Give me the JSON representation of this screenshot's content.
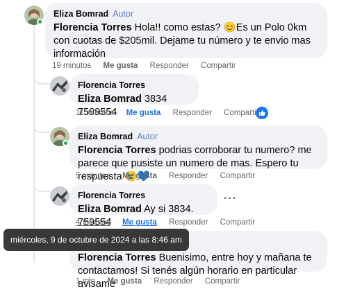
{
  "comments": [
    {
      "author": "Eliza Bomrad",
      "badge": "Autor",
      "mention": "Florencia Torres",
      "text": "Hola!! como estas? 😊Es un Polo 0km con cuotas de $205mil. Dejame tu número y te envio mas información",
      "time": "19 minutos",
      "like": "Me gusta",
      "reply": "Responder",
      "share": "Compartir"
    },
    {
      "author": "Florencia Torres",
      "mention": "Eliza Bomrad",
      "text": "3834 7599554",
      "time": "11 minutos",
      "like": "Me gusta",
      "reply": "Responder",
      "share": "Compartir"
    },
    {
      "author": "Eliza Bomrad",
      "badge": "Autor",
      "mention": "Florencia Torres",
      "text": "podrias corroborar tu numero? me parece que pusiste un numero de mas. Espero tu respuesta 😢💙",
      "time": "5 minutos",
      "like": "Me gusta",
      "reply": "Responder",
      "share": "Compartir"
    },
    {
      "author": "Florencia Torres",
      "mention": "Eliza Bomrad",
      "text": "Ay si 3834. 759554",
      "time": "4 minutos",
      "like": "Me gusta",
      "reply": "Responder",
      "share": "Compartir"
    },
    {
      "mention": "Florencia Torres",
      "text": "Buenisimo, entre hoy y mañana te contactamos! Si tenés algún horario en particular avisame",
      "time": "1 min",
      "like": "Me gusta",
      "reply": "Responder",
      "share": "Compartir"
    }
  ],
  "tooltip": "miércoles, 9 de octubre de 2024 a las 8:46 am",
  "colors": {
    "like_blue": "#1877f2",
    "online": "#31a24c",
    "bubble": "#f0f2f5",
    "author_badge": "#5b7fcf"
  },
  "icons": [
    "like-reaction-icon",
    "more-options-icon",
    "online-status-icon"
  ]
}
